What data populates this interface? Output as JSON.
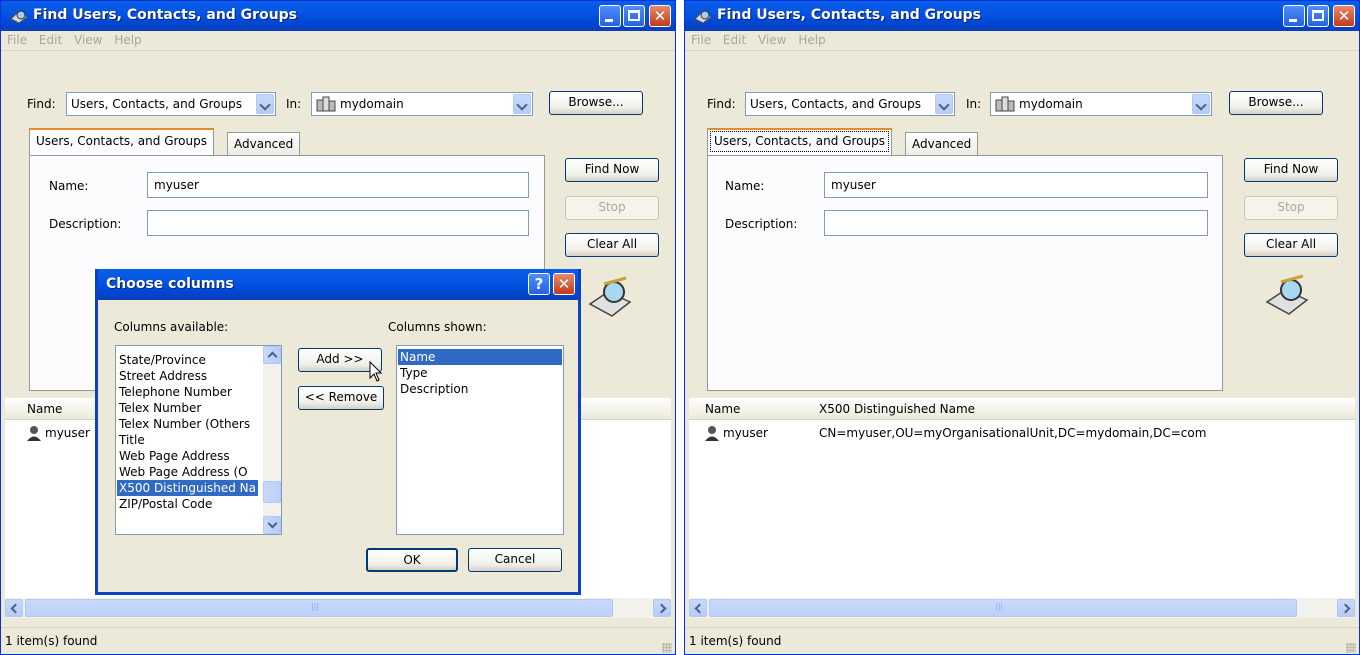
{
  "left": {
    "title": "Find Users, Contacts, and Groups",
    "menu": [
      "File",
      "Edit",
      "View",
      "Help"
    ],
    "find_label": "Find:",
    "find_value": "Users, Contacts, and Groups",
    "in_label": "In:",
    "in_value": "mydomain",
    "browse": "Browse...",
    "tabs": [
      "Users, Contacts, and Groups",
      "Advanced"
    ],
    "name_label": "Name:",
    "name_value": "myuser",
    "desc_label": "Description:",
    "find_now": "Find Now",
    "stop": "Stop",
    "clear_all": "Clear All",
    "col_name": "Name",
    "row_name": "myuser",
    "status": "1 item(s) found"
  },
  "dialog": {
    "title": "Choose columns",
    "available_label": "Columns available:",
    "available": [
      "State/Province",
      "Street Address",
      "Telephone Number",
      "Telex Number",
      "Telex Number (Others",
      "Title",
      "Web Page Address",
      "Web Page Address (O",
      "X500 Distinguished Na",
      "ZIP/Postal Code"
    ],
    "available_selected_index": 8,
    "shown_label": "Columns shown:",
    "shown": [
      "Name",
      "Type",
      "Description"
    ],
    "shown_selected_index": 0,
    "add": "Add >>",
    "remove": "<< Remove",
    "ok": "OK",
    "cancel": "Cancel"
  },
  "right": {
    "title": "Find Users, Contacts, and Groups",
    "menu": [
      "File",
      "Edit",
      "View",
      "Help"
    ],
    "find_label": "Find:",
    "find_value": "Users, Contacts, and Groups",
    "in_label": "In:",
    "in_value": "mydomain",
    "browse": "Browse...",
    "tabs": [
      "Users, Contacts, and Groups",
      "Advanced"
    ],
    "name_label": "Name:",
    "name_value": "myuser",
    "desc_label": "Description:",
    "find_now": "Find Now",
    "stop": "Stop",
    "clear_all": "Clear All",
    "col_name": "Name",
    "col_x500": "X500 Distinguished Name",
    "row_name": "myuser",
    "row_x500": "CN=myuser,OU=myOrganisationalUnit,DC=mydomain,DC=com",
    "status": "1 item(s) found"
  },
  "colors": {
    "title_blue": "#0554e3",
    "selection": "#316ac5",
    "face": "#ece9d8",
    "close_red": "#c4391b"
  }
}
